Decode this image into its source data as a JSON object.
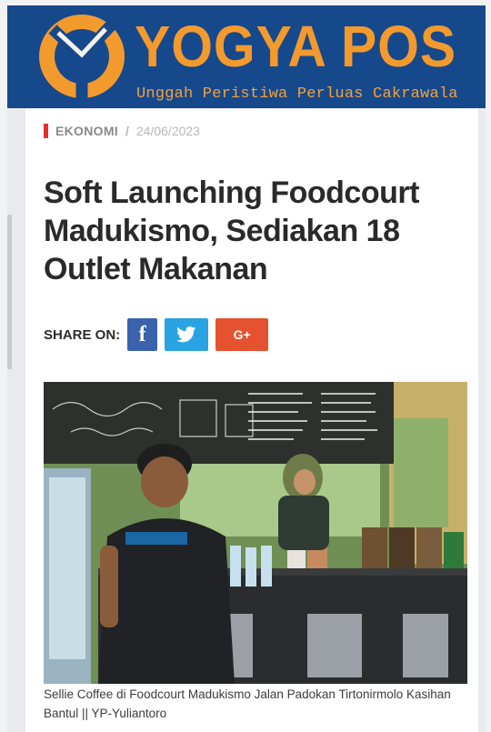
{
  "site": {
    "brand": "YOGYA POS",
    "tagline": "Unggah Peristiwa Perluas Cakrawala",
    "logo_icon": "yogyapos-logo-icon",
    "colors": {
      "header_bg": "#16488c",
      "brand_orange": "#f39a2d"
    }
  },
  "article": {
    "category": "EKONOMI",
    "separator": "/",
    "date": "24/06/2023",
    "title": "Soft Launching Foodcourt Madukismo, Sediakan 18 Outlet Makanan",
    "share_label": "SHARE ON:",
    "share_buttons": [
      {
        "icon": "facebook-icon",
        "color": "#3b62ad"
      },
      {
        "icon": "twitter-icon",
        "color": "#2aa3e2"
      },
      {
        "icon": "google-plus-icon",
        "color": "#e45230",
        "label": "G"
      }
    ],
    "photo_caption": "Sellie Coffee di Foodcourt Madukismo Jalan Padokan Tirtonirmolo Kasihan Bantul || YP-Yuliantoro"
  }
}
